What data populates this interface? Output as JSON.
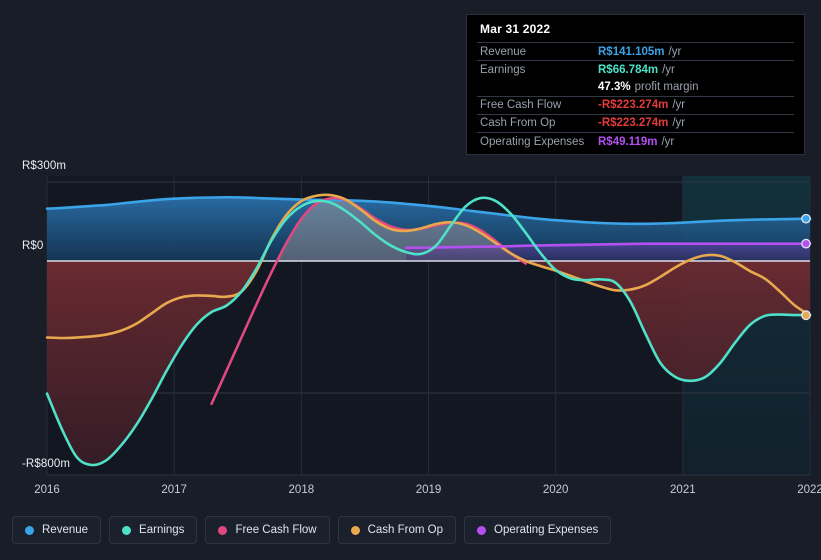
{
  "chart_data": {
    "type": "area",
    "title": "",
    "xlabel": "",
    "ylabel": "",
    "currency": "R$",
    "unit": "m",
    "period_suffix": "/yr",
    "ylim": [
      -800,
      300
    ],
    "y_ticks": [
      {
        "value": 300,
        "label": "R$300m"
      },
      {
        "value": 0,
        "label": "R$0"
      },
      {
        "value": -400,
        "label": ""
      },
      {
        "value": -800,
        "label": "-R$800m"
      }
    ],
    "x_ticks": [
      "2016",
      "2017",
      "2018",
      "2019",
      "2020",
      "2021",
      "2022"
    ],
    "grid": true,
    "legend_position": "bottom-left",
    "forecast_start": "2021",
    "series": [
      {
        "name": "Revenue",
        "color": "#3ba3e8",
        "fill": "#1d4a73",
        "values": [
          205,
          208,
          212,
          216,
          220,
          226,
          232,
          238,
          243,
          246,
          248,
          249,
          250,
          249,
          247,
          245,
          243,
          241,
          240,
          239,
          238,
          236,
          233,
          229,
          224,
          219,
          213,
          206,
          199,
          192,
          185,
          178,
          171,
          165,
          160,
          156,
          152,
          149,
          147,
          146,
          146,
          147,
          149,
          152,
          155,
          158,
          160,
          162,
          163,
          164,
          165,
          166
        ]
      },
      {
        "name": "Earnings",
        "color": "#4fe0c8",
        "fill": "#5a2630",
        "values": [
          -520,
          -660,
          -770,
          -800,
          -780,
          -720,
          -640,
          -540,
          -430,
          -330,
          -250,
          -200,
          -175,
          -120,
          -30,
          80,
          165,
          215,
          235,
          228,
          195,
          150,
          100,
          60,
          35,
          28,
          60,
          140,
          215,
          247,
          235,
          185,
          110,
          30,
          -35,
          -68,
          -75,
          -72,
          -85,
          -160,
          -285,
          -400,
          -455,
          -470,
          -455,
          -400,
          -320,
          -250,
          -215,
          -210,
          -212,
          -212
        ]
      },
      {
        "name": "Free Cash Flow",
        "color": "#e0497f",
        "fill": "#6b3050",
        "values": [
          null,
          null,
          null,
          null,
          null,
          null,
          null,
          null,
          null,
          null,
          null,
          -560,
          -430,
          -300,
          -170,
          -45,
          70,
          165,
          225,
          246,
          238,
          205,
          165,
          135,
          122,
          126,
          140,
          150,
          146,
          120,
          78,
          30,
          -10,
          null,
          null,
          null,
          null,
          null,
          null,
          null,
          null,
          null,
          null,
          null,
          null,
          null,
          null,
          null,
          null,
          null,
          null,
          null
        ]
      },
      {
        "name": "Cash From Op",
        "color": "#e8a84e",
        "fill": "#5a2630",
        "values": [
          -300,
          -302,
          -300,
          -296,
          -288,
          -272,
          -245,
          -205,
          -165,
          -142,
          -135,
          -137,
          -140,
          -120,
          -40,
          85,
          180,
          235,
          256,
          258,
          240,
          200,
          155,
          125,
          118,
          128,
          145,
          152,
          140,
          110,
          70,
          30,
          0,
          -20,
          -38,
          -58,
          -80,
          -100,
          -115,
          -112,
          -95,
          -62,
          -25,
          5,
          22,
          20,
          -5,
          -40,
          -70,
          -120,
          -175,
          -213
        ]
      },
      {
        "name": "Operating Expenses",
        "color": "#b44ff0",
        "fill": "#3c2c6b",
        "values": [
          null,
          null,
          null,
          null,
          null,
          null,
          null,
          null,
          null,
          null,
          null,
          null,
          null,
          null,
          null,
          null,
          null,
          null,
          null,
          null,
          null,
          null,
          null,
          null,
          52,
          52,
          53,
          54,
          55,
          56,
          57,
          58,
          60,
          61,
          62,
          63,
          64,
          65,
          66,
          67,
          68,
          68,
          68,
          68,
          68,
          68,
          68,
          68,
          68,
          68,
          68,
          68
        ]
      }
    ],
    "endpoints": [
      {
        "name": "Revenue",
        "value": 166,
        "color": "#3ba3e8"
      },
      {
        "name": "Operating Expenses",
        "value": 68,
        "color": "#b44ff0"
      },
      {
        "name": "Earnings",
        "value": -212,
        "color": "#4fe0c8"
      },
      {
        "name": "Cash From Op",
        "value": -213,
        "color": "#e8a84e"
      }
    ]
  },
  "tooltip": {
    "date": "Mar 31 2022",
    "rows": [
      {
        "key": "Revenue",
        "value": "R$141.105m",
        "suffix": "/yr",
        "color": "#3ba3e8"
      },
      {
        "key": "Earnings",
        "value": "R$66.784m",
        "suffix": "/yr",
        "color": "#4fe0c8"
      },
      {
        "key": "",
        "value": "47.3%",
        "suffix": "profit margin",
        "color": "#ffffff"
      },
      {
        "key": "Free Cash Flow",
        "value": "-R$223.274m",
        "suffix": "/yr",
        "color": "#e33b3b"
      },
      {
        "key": "Cash From Op",
        "value": "-R$223.274m",
        "suffix": "/yr",
        "color": "#e33b3b"
      },
      {
        "key": "Operating Expenses",
        "value": "R$49.119m",
        "suffix": "/yr",
        "color": "#b44ff0"
      }
    ]
  },
  "legend": {
    "items": [
      {
        "label": "Revenue",
        "color": "#3ba3e8"
      },
      {
        "label": "Earnings",
        "color": "#4fe0c8"
      },
      {
        "label": "Free Cash Flow",
        "color": "#e0497f"
      },
      {
        "label": "Cash From Op",
        "color": "#e8a84e"
      },
      {
        "label": "Operating Expenses",
        "color": "#b44ff0"
      }
    ]
  }
}
